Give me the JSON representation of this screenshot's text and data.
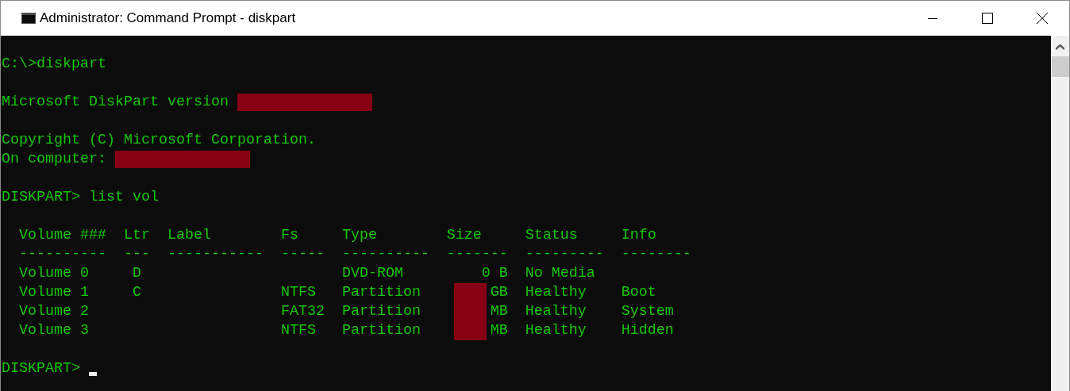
{
  "window": {
    "title": "Administrator: Command Prompt - diskpart"
  },
  "console": {
    "lines": [
      {
        "kind": "blank"
      },
      {
        "kind": "text",
        "text": "C:\\>diskpart"
      },
      {
        "kind": "blank"
      },
      {
        "kind": "text",
        "text": "Microsoft DiskPart version",
        "redacted": true
      },
      {
        "kind": "blank"
      },
      {
        "kind": "text",
        "text": "Copyright (C) Microsoft Corporation."
      },
      {
        "kind": "text",
        "text": "On computer:",
        "redacted": true
      },
      {
        "kind": "blank"
      },
      {
        "kind": "text",
        "text": "DISKPART> list vol"
      },
      {
        "kind": "blank"
      },
      {
        "kind": "table",
        "columns": [
          {
            "label": "Volume ###",
            "rule": "----------"
          },
          {
            "label": "Ltr",
            "rule": "---"
          },
          {
            "label": "Label",
            "rule": "-----------"
          },
          {
            "label": "Fs",
            "rule": "-----"
          },
          {
            "label": "Type",
            "rule": "----------"
          },
          {
            "label": "Size",
            "rule": "-------"
          },
          {
            "label": "Status",
            "rule": "---------"
          },
          {
            "label": "Info",
            "rule": "--------"
          }
        ],
        "rows": [
          {
            "volume": "Volume 0",
            "ltr": "D",
            "type": "DVD-ROM",
            "size": {
              "text": "0 B",
              "redacted": false
            },
            "status": "No Media"
          },
          {
            "volume": "Volume 1",
            "ltr": "C",
            "fs": "NTFS",
            "type": "Partition",
            "size": {
              "text": "GB",
              "redacted": true
            },
            "status": "Healthy",
            "info": "Boot"
          },
          {
            "volume": "Volume 2",
            "fs": "FAT32",
            "type": "Partition",
            "size": {
              "text": "MB",
              "redacted": true
            },
            "status": "Healthy",
            "info": "System"
          },
          {
            "volume": "Volume 3",
            "fs": "NTFS",
            "type": "Partition",
            "size": {
              "text": "MB",
              "redacted": true
            },
            "status": "Healthy",
            "info": "Hidden"
          }
        ]
      },
      {
        "kind": "blank"
      },
      {
        "kind": "prompt",
        "text": "DISKPART>",
        "cursor": true
      }
    ]
  }
}
